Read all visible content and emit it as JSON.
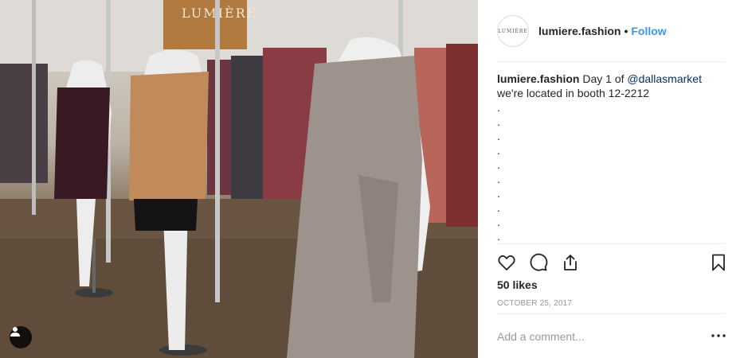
{
  "post": {
    "account": {
      "username": "lumiere.fashion",
      "avatar_text": "LUMIÈRE",
      "separator": "•",
      "follow_label": "Follow"
    },
    "caption": {
      "username": "lumiere.fashion",
      "text_before": " Day 1 of ",
      "mention": "@dallasmarket",
      "line2": "we're located in booth 12-2212",
      "dot_lines": [
        ".",
        ".",
        ".",
        ".",
        ".",
        ".",
        ".",
        ".",
        ".",
        "."
      ]
    },
    "likes_label": "50 likes",
    "date_label": "OCTOBER 25, 2017",
    "comment_placeholder": "Add a comment...",
    "more_label": "•••"
  },
  "photo": {
    "store_sign_text": "LUMIÈRE"
  },
  "icons": [
    "user-tag-icon",
    "heart-icon",
    "comment-icon",
    "share-icon",
    "bookmark-icon",
    "more-options-icon"
  ],
  "colors": {
    "accent": "#3897f0",
    "mention": "#003569",
    "text": "#262626",
    "muted": "#999999",
    "divider": "#efefef"
  }
}
